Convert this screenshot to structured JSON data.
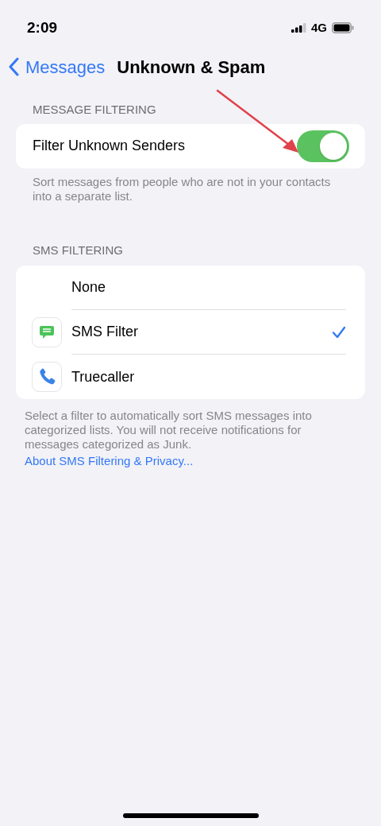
{
  "status_bar": {
    "time": "2:09",
    "network": "4G"
  },
  "nav": {
    "back": "Messages",
    "title": "Unknown & Spam"
  },
  "message_filtering": {
    "header": "MESSAGE FILTERING",
    "toggle": {
      "label": "Filter Unknown Senders",
      "on": true
    },
    "footer": "Sort messages from people who are not in your contacts into a separate list."
  },
  "sms_filtering": {
    "header": "SMS FILTERING",
    "options": [
      {
        "label": "None",
        "kind": "none",
        "selected": false
      },
      {
        "label": "SMS Filter",
        "kind": "message",
        "selected": true
      },
      {
        "label": "Truecaller",
        "kind": "phone",
        "selected": false
      }
    ],
    "footer": "Select a filter to automatically sort SMS messages into categorized lists. You will not receive notifications for messages categorized as Junk.",
    "link": "About SMS Filtering & Privacy..."
  }
}
